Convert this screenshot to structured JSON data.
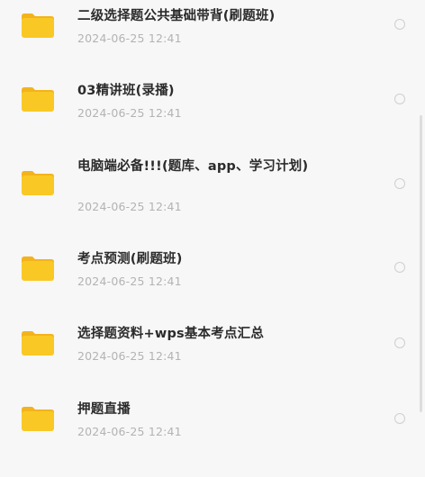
{
  "files": [
    {
      "name": "二级选择题公共基础带背(刷题班)",
      "date": "2024-06-25 12:41",
      "icon": "folder-icon"
    },
    {
      "name": "03精讲班(录播)",
      "date": "2024-06-25 12:41",
      "icon": "folder-icon"
    },
    {
      "name": "电脑端必备!!!(题库、app、学习计划)",
      "date": "2024-06-25 12:41",
      "icon": "folder-icon"
    },
    {
      "name": "考点预测(刷题班)",
      "date": "2024-06-25 12:41",
      "icon": "folder-icon"
    },
    {
      "name": "选择题资料+wps基本考点汇总",
      "date": "2024-06-25 12:41",
      "icon": "folder-icon"
    },
    {
      "name": "押题直播",
      "date": "2024-06-25 12:41",
      "icon": "folder-icon"
    }
  ],
  "colors": {
    "folder_body": "#f9c825",
    "folder_tab": "#f3b31c",
    "title_text": "#2b2b2b",
    "date_text": "#b3b3b3",
    "background": "#f7f7f7"
  }
}
